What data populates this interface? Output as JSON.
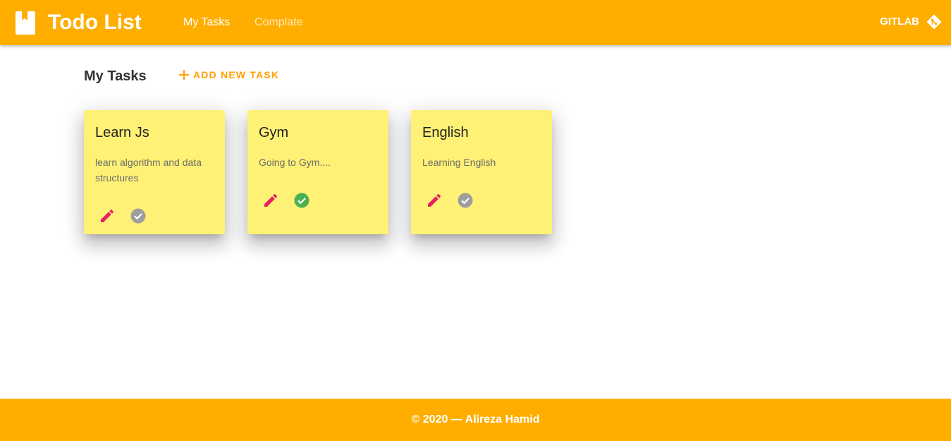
{
  "header": {
    "app_title": "Todo List",
    "logo_icon": "clipboard-icon",
    "nav": [
      {
        "label": "My Tasks",
        "active": true
      },
      {
        "label": "Complate",
        "active": false
      }
    ],
    "gitlab": {
      "label": "GITLAB",
      "icon": "git-icon"
    }
  },
  "main": {
    "title": "My Tasks",
    "add_button_label": "ADD NEW TASK",
    "tasks": [
      {
        "title": "Learn Js",
        "description": "learn algorithm and data structures",
        "completed": false
      },
      {
        "title": "Gym",
        "description": "Going to Gym....",
        "completed": true
      },
      {
        "title": "English",
        "description": "Learning English",
        "completed": false
      }
    ]
  },
  "footer": {
    "text": "© 2020 — Alireza Hamid"
  },
  "colors": {
    "primary": "#ffae00",
    "card": "#fff176",
    "accent": "#ffa000",
    "edit_icon": "#e91e63",
    "done": "#4caf50",
    "not_done": "#9e9e9e"
  }
}
